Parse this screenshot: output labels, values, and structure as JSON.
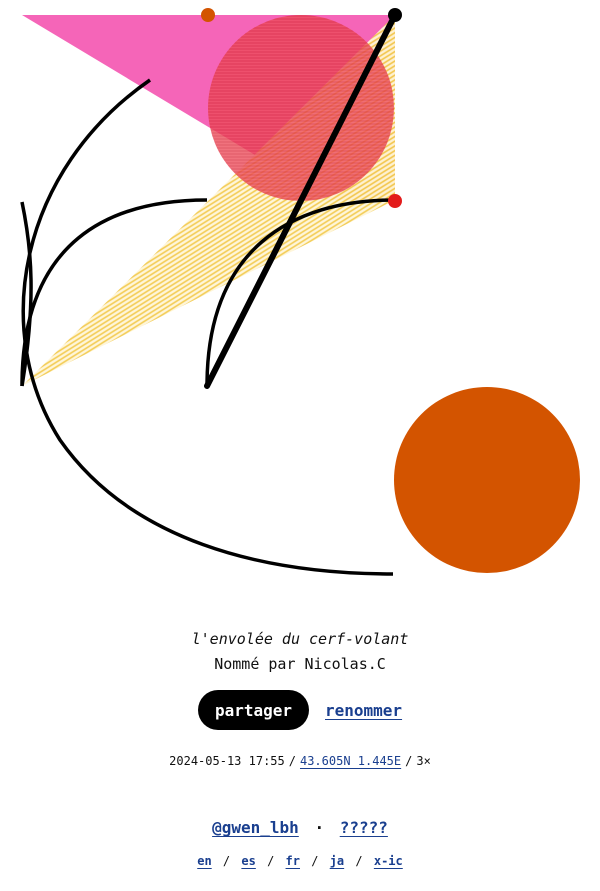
{
  "artwork": {
    "colors": {
      "pink": "#f565b8",
      "red": "#e8324a",
      "orange": "#f58a4f",
      "yellow": "#f7d35a",
      "dark_orange": "#d35400",
      "red_dot": "#e31b1b",
      "ink": "#000000"
    }
  },
  "caption": {
    "title": "l'envolée du cerf-volant",
    "byline": "Nommé par Nicolas.C"
  },
  "actions": {
    "share_label": "partager",
    "rename_label": "renommer"
  },
  "meta": {
    "datetime": "2024-05-13 17:55",
    "separator": "/",
    "coordinates": "43.605N 1.445E",
    "multiplier": "3×"
  },
  "social": {
    "handle": "@gwen_lbh",
    "dot": "·",
    "other": "?????"
  },
  "languages": [
    "en",
    "es",
    "fr",
    "ja",
    "x-ic"
  ],
  "lang_separator": "/"
}
